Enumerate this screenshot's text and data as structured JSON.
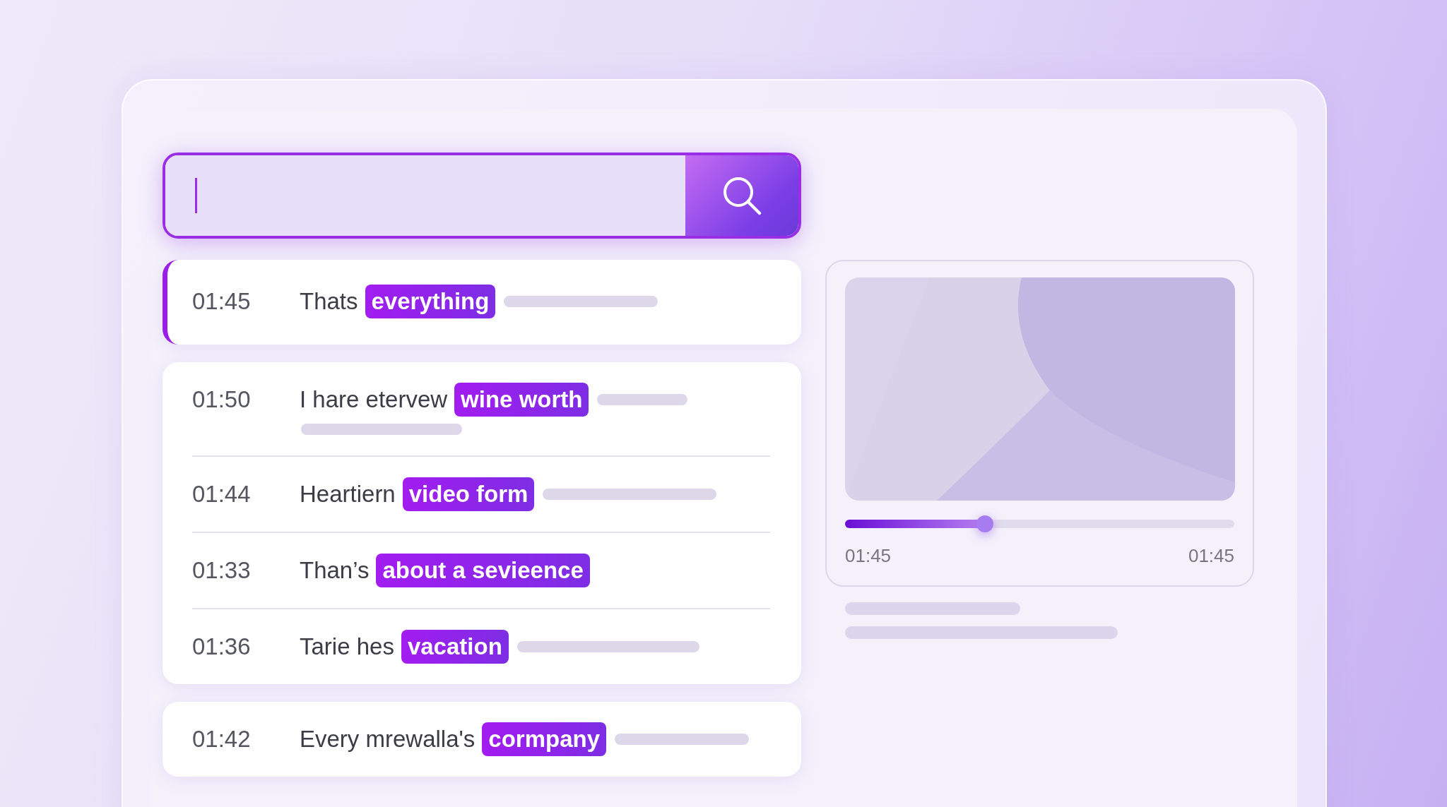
{
  "search": {
    "caret": true
  },
  "results": [
    {
      "rows": [
        {
          "time": "01:45",
          "text": "Thats",
          "highlight": "everything",
          "selected": true
        }
      ]
    },
    {
      "rows": [
        {
          "time": "01:50",
          "text": "I hare etervew",
          "highlight": "wine worth",
          "selected": false
        },
        {
          "time": "01:44",
          "text": "Heartiern",
          "highlight": "video form",
          "selected": false
        },
        {
          "time": "01:33",
          "text": "Than’s",
          "highlight": "about a sevieence",
          "selected": false
        },
        {
          "time": "01:36",
          "text": "Tarie hes",
          "highlight": "vacation",
          "selected": false
        }
      ]
    },
    {
      "rows": [
        {
          "time": "01:42",
          "text": "Every mrewalla's",
          "highlight": "cormpany",
          "selected": false
        }
      ]
    }
  ],
  "player": {
    "level": 0.36,
    "current_time": "01:45",
    "total_time": "01:45"
  }
}
